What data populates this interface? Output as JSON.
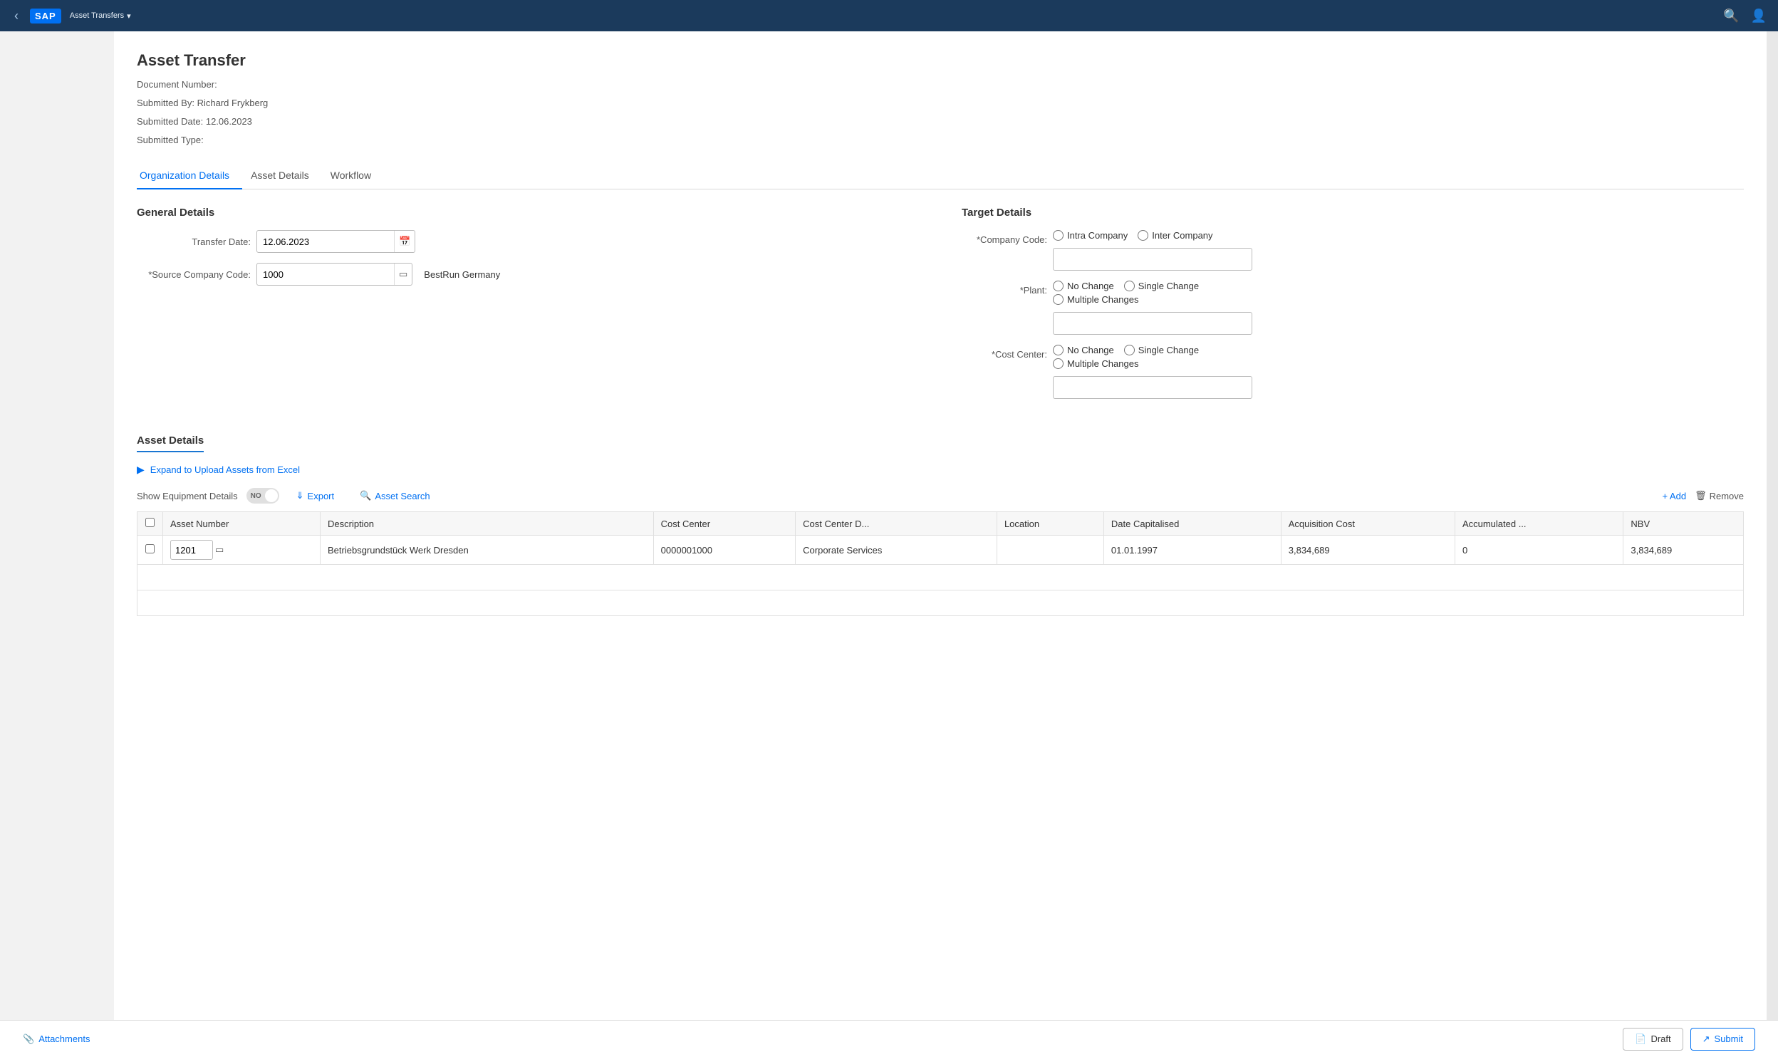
{
  "nav": {
    "back_label": "‹",
    "logo": "SAP",
    "title": "Asset Transfers",
    "dropdown_icon": "▾",
    "search_icon": "🔍",
    "user_icon": "👤"
  },
  "page": {
    "title": "Asset Transfer",
    "document_number_label": "Document Number:",
    "document_number_value": "",
    "submitted_by_label": "Submitted By:",
    "submitted_by_value": "Richard Frykberg",
    "submitted_date_label": "Submitted Date:",
    "submitted_date_value": "12.06.2023",
    "submitted_type_label": "Submitted Type:",
    "submitted_type_value": ""
  },
  "tabs": [
    {
      "id": "org-details",
      "label": "Organization Details",
      "active": true
    },
    {
      "id": "asset-details",
      "label": "Asset Details",
      "active": false
    },
    {
      "id": "workflow",
      "label": "Workflow",
      "active": false
    }
  ],
  "general_details": {
    "header": "General Details",
    "transfer_date_label": "Transfer Date:",
    "transfer_date_value": "12.06.2023",
    "source_company_code_label": "*Source Company Code:",
    "source_company_code_value": "1000",
    "source_company_name": "BestRun Germany"
  },
  "target_details": {
    "header": "Target Details",
    "company_code_label": "*Company Code:",
    "company_code_options": [
      {
        "id": "intra",
        "label": "Intra Company"
      },
      {
        "id": "inter",
        "label": "Inter Company"
      }
    ],
    "company_code_input_placeholder": "",
    "plant_label": "*Plant:",
    "plant_options": [
      {
        "id": "no-change",
        "label": "No Change"
      },
      {
        "id": "single-change",
        "label": "Single Change"
      },
      {
        "id": "multiple-changes",
        "label": "Multiple Changes"
      }
    ],
    "plant_input_placeholder": "",
    "cost_center_label": "*Cost Center:",
    "cost_center_options": [
      {
        "id": "no-change-cc",
        "label": "No Change"
      },
      {
        "id": "single-change-cc",
        "label": "Single Change"
      },
      {
        "id": "multiple-changes-cc",
        "label": "Multiple Changes"
      }
    ],
    "cost_center_input_placeholder": ""
  },
  "asset_details_section": {
    "header": "Asset Details",
    "expand_label": "Expand to Upload Assets from Excel",
    "show_equipment_label": "Show Equipment Details",
    "toggle_state": "NO",
    "export_btn": "Export",
    "asset_search_btn": "Asset Search",
    "add_btn": "+ Add",
    "remove_btn": "Remove",
    "table": {
      "columns": [
        "",
        "Asset Number",
        "Description",
        "Cost Center",
        "Cost Center D...",
        "Location",
        "Date Capitalised",
        "Acquisition Cost",
        "Accumulated ...",
        "NBV"
      ],
      "rows": [
        {
          "selected": false,
          "asset_number": "1201",
          "description": "Betriebsgrundstück Werk Dresden",
          "cost_center": "0000001000",
          "cost_center_d": "Corporate Services",
          "location": "",
          "date_capitalised": "01.01.1997",
          "acquisition_cost": "3,834,689",
          "accumulated": "0",
          "nbv": "3,834,689"
        }
      ]
    }
  },
  "footer": {
    "attachments_label": "Attachments",
    "draft_btn": "Draft",
    "submit_btn": "Submit"
  }
}
